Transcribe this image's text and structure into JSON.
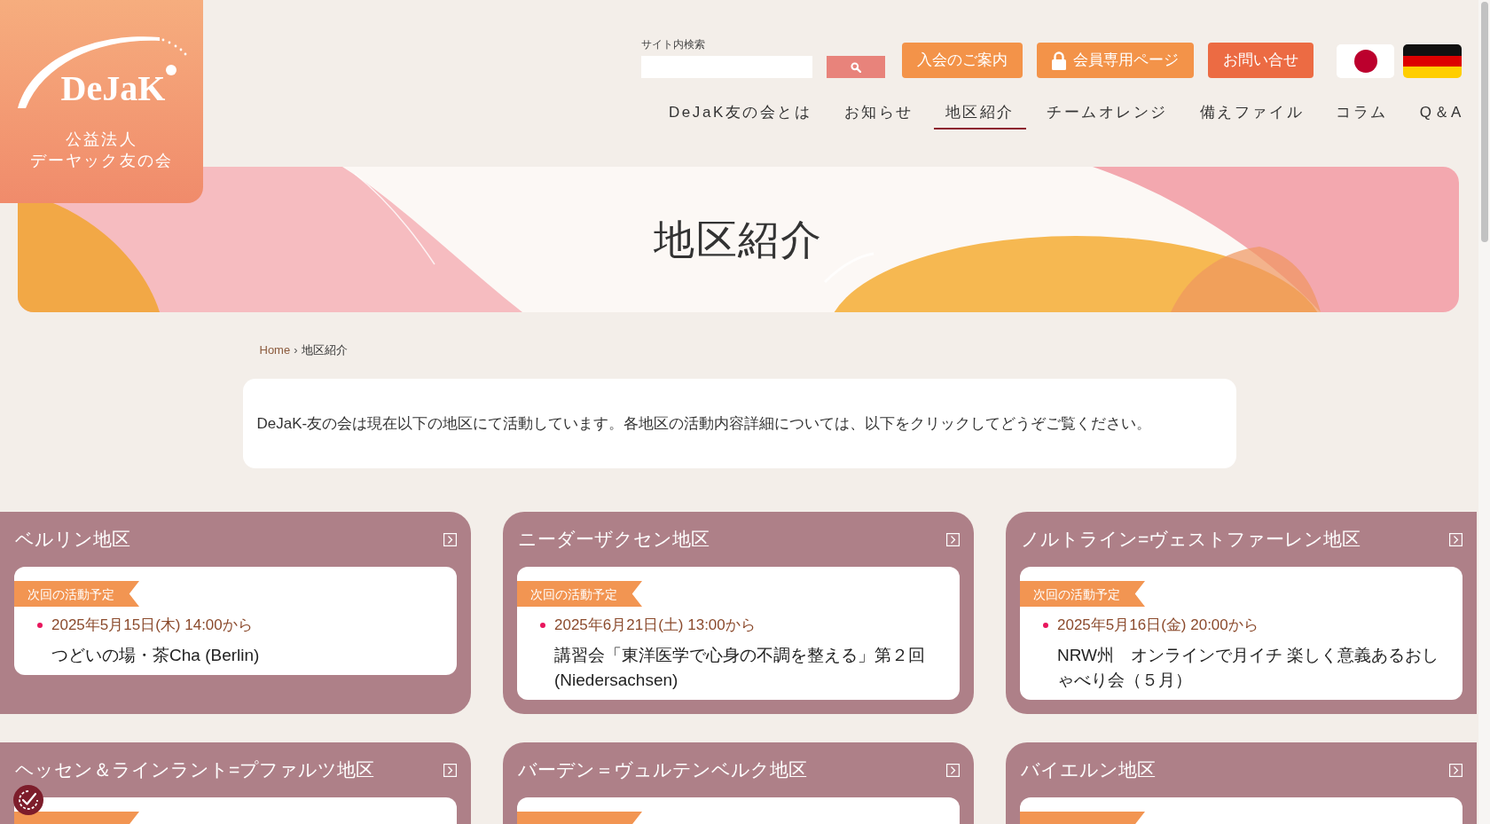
{
  "logo": {
    "wordmark": "DeJaK",
    "lines": [
      "公益法人",
      "デーヤック友の会"
    ]
  },
  "search": {
    "label": "サイト内検索"
  },
  "header_buttons": [
    {
      "label": "入会のご案内",
      "kind": "info"
    },
    {
      "label": "会員専用ページ",
      "kind": "members"
    },
    {
      "label": "お問い合せ",
      "kind": "contact"
    }
  ],
  "languages": [
    {
      "kind": "japanese"
    },
    {
      "kind": "german"
    }
  ],
  "nav": [
    {
      "label": "DeJaK友の会とは",
      "selected": false
    },
    {
      "label": "お知らせ",
      "selected": false
    },
    {
      "label": "地区紹介",
      "selected": true
    },
    {
      "label": "チームオレンジ",
      "selected": false
    },
    {
      "label": "備えファイル",
      "selected": false
    },
    {
      "label": "コラム",
      "selected": false
    },
    {
      "label": "Q＆A",
      "selected": false
    }
  ],
  "banner": {
    "title": "地区紹介"
  },
  "breadcrumb": {
    "items": [
      {
        "label": "Home",
        "kind": "link"
      },
      {
        "label": "地区紹介",
        "kind": "current"
      }
    ],
    "separator": "›"
  },
  "intro": "DeJaK-友の会は現在以下の地区にて活動しています。各地区の活動内容詳細については、以下をクリックしてどうぞご覧ください。",
  "regions": [
    {
      "name": "ベルリン地区",
      "schedule": {
        "tag": "次回の活動予定",
        "date": "2025年5月15日(木) 14:00から",
        "event": "つどいの場・茶Cha (Berlin)"
      }
    },
    {
      "name": "ニーダーザクセン地区",
      "schedule": {
        "tag": "次回の活動予定",
        "date": "2025年6月21日(土) 13:00から",
        "event": "講習会「東洋医学で心身の不調を整える」第２回(Niedersachsen)"
      }
    },
    {
      "name": "ノルトライン=ヴェストファーレン地区",
      "schedule": {
        "tag": "次回の活動予定",
        "date": "2025年5月16日(金) 20:00から",
        "event": "NRW州　オンラインで月イチ 楽しく意義あるおしゃべり会（５月）"
      }
    },
    {
      "name": "ヘッセン＆ラインラント=プファルツ地区"
    },
    {
      "name": "バーデン＝ヴュルテンベルク地区"
    },
    {
      "name": "バイエルン地区"
    }
  ]
}
